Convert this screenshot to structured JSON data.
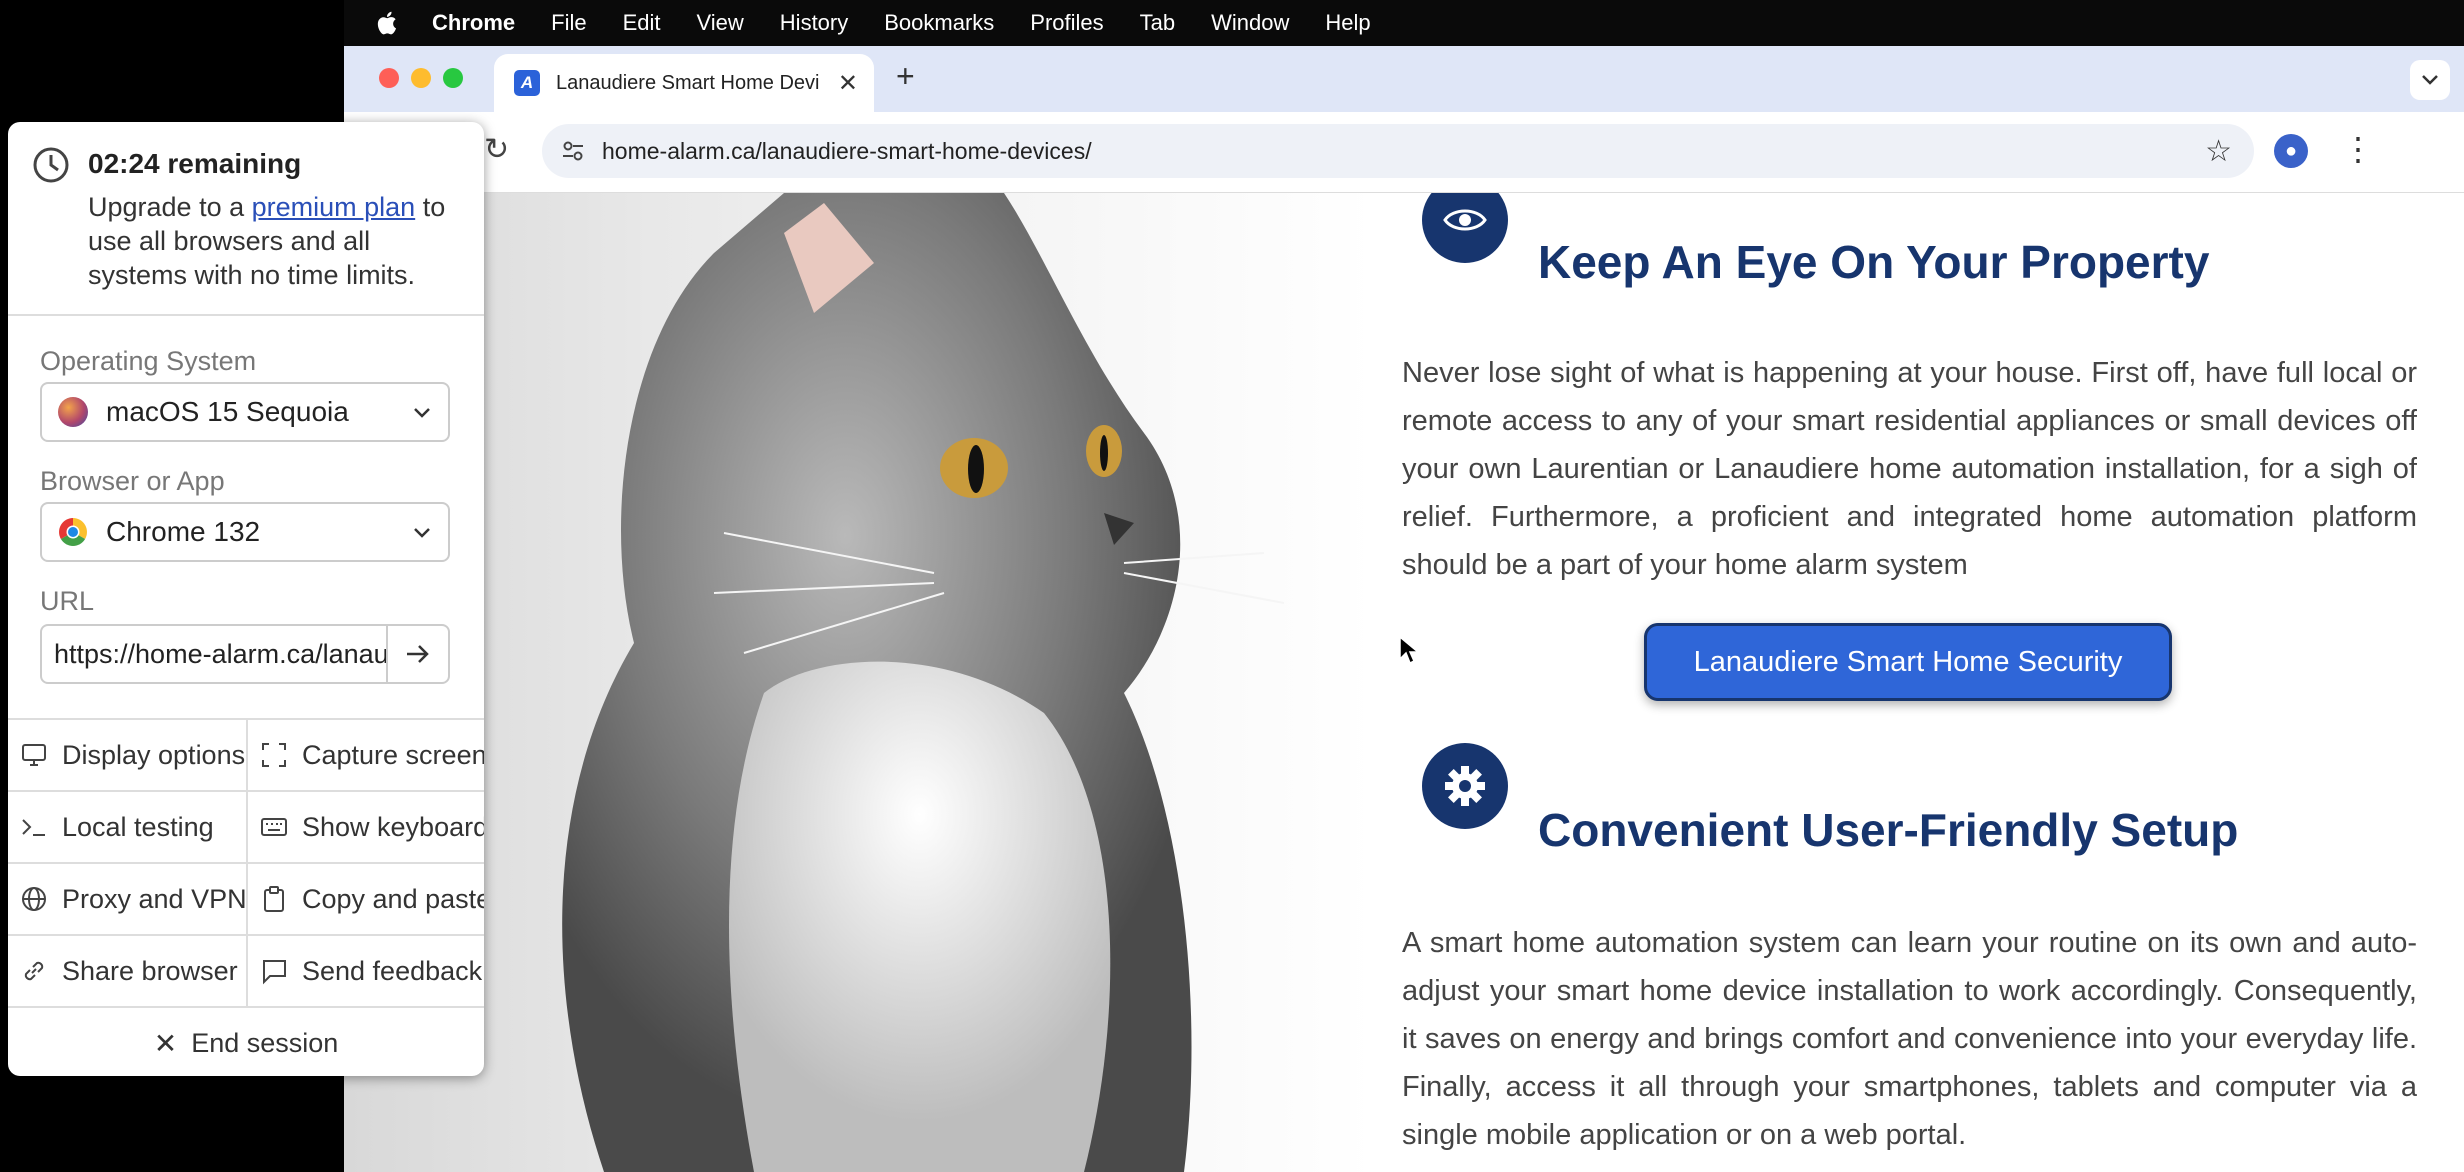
{
  "menubar": {
    "app": "Chrome",
    "items": [
      "File",
      "Edit",
      "View",
      "History",
      "Bookmarks",
      "Profiles",
      "Tab",
      "Window",
      "Help"
    ]
  },
  "browser": {
    "tab_title": "Lanaudiere Smart Home Devi",
    "url": "home-alarm.ca/lanaudiere-smart-home-devices/"
  },
  "page": {
    "section1_title": "Keep An Eye On Your Property",
    "section1_text": "Never lose sight of what is happening at your house. First off, have full local or remote access to any of your smart residential appliances or small devices off your own Laurentian or Lanaudiere home automation installation, for a sigh of relief. Furthermore, a proficient and integrated home automation platform should be a part of your home alarm system",
    "cta_label": "Lanaudiere Smart Home Security",
    "section2_title": "Convenient User-Friendly Setup",
    "section2_text": "A smart home automation system can learn your routine on its own and auto-adjust your smart home device installation to work accordingly. Consequently, it saves on energy and brings comfort and convenience into your everyday life. Finally, access it all through your smartphones, tablets and computer via a single mobile application or on a web portal."
  },
  "panel": {
    "timer": "02:24 remaining",
    "upgrade_prefix": "Upgrade to a ",
    "upgrade_link": "premium plan",
    "upgrade_suffix": " to use all browsers and all systems with no time limits.",
    "os_label": "Operating System",
    "os_value": "macOS 15 Sequoia",
    "browser_label": "Browser or App",
    "browser_value": "Chrome 132",
    "url_label": "URL",
    "url_value": "https://home-alarm.ca/lanaudiere-smart-home-devices/",
    "actions": {
      "display": "Display options",
      "capture": "Capture screenshot",
      "local": "Local testing",
      "keyboard": "Show keyboard",
      "proxy": "Proxy and VPN",
      "copy": "Copy and paste",
      "share": "Share browser",
      "feedback": "Send feedback"
    },
    "end_session": "End session"
  },
  "colors": {
    "brand_navy": "#17356e",
    "cta_blue": "#2f66d8",
    "link_blue": "#2a4fb8"
  }
}
